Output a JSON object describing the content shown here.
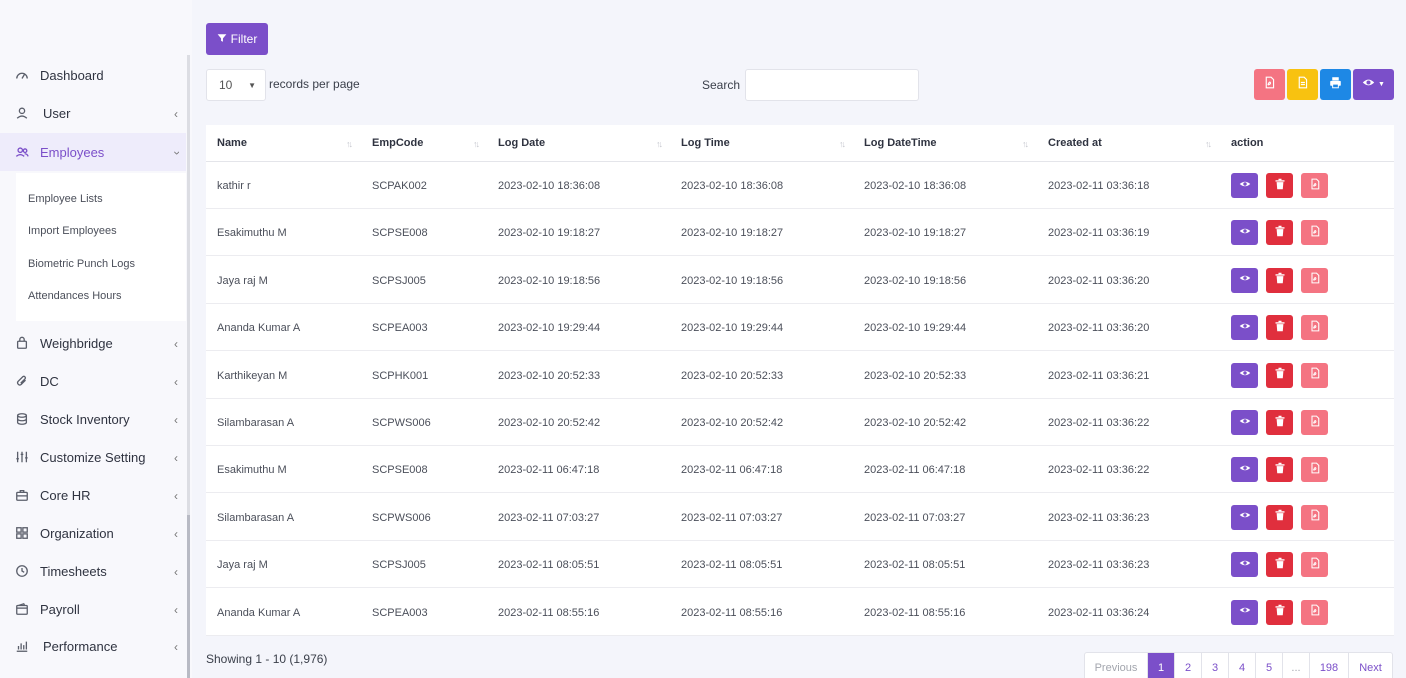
{
  "sidebar": {
    "items": [
      {
        "label": "Dashboard",
        "icon": "dashboard-icon"
      },
      {
        "label": "User",
        "icon": "user-icon"
      },
      {
        "label": "Employees",
        "icon": "users-icon"
      },
      {
        "label": "Weighbridge",
        "icon": "bag-icon"
      },
      {
        "label": "DC",
        "icon": "paperclip-icon"
      },
      {
        "label": "Stock Inventory",
        "icon": "database-icon"
      },
      {
        "label": "Customize Setting",
        "icon": "sliders-icon"
      },
      {
        "label": "Core HR",
        "icon": "briefcase-icon"
      },
      {
        "label": "Organization",
        "icon": "grid-icon"
      },
      {
        "label": "Timesheets",
        "icon": "clock-icon"
      },
      {
        "label": "Payroll",
        "icon": "wallet-icon"
      },
      {
        "label": "Performance",
        "icon": "bar-chart-icon"
      }
    ],
    "employees_submenu": [
      "Employee Lists",
      "Import Employees",
      "Biometric Punch Logs",
      "Attendances Hours"
    ]
  },
  "toolbar": {
    "filter_label": "Filter",
    "per_page_value": "10",
    "per_page_label": "records per page",
    "search_label": "Search",
    "search_value": "",
    "export_buttons": [
      {
        "name": "pdf-export",
        "color": "#f47482"
      },
      {
        "name": "csv-export",
        "color": "#f8c210"
      },
      {
        "name": "print",
        "color": "#1e88e5"
      },
      {
        "name": "column-visibility",
        "color": "#7b4fc9"
      }
    ]
  },
  "table": {
    "columns": [
      "Name",
      "EmpCode",
      "Log Date",
      "Log Time",
      "Log DateTime",
      "Created at",
      "action"
    ],
    "rows": [
      [
        "kathir r",
        "SCPAK002",
        "2023-02-10 18:36:08",
        "2023-02-10 18:36:08",
        "2023-02-10 18:36:08",
        "2023-02-11 03:36:18"
      ],
      [
        "Esakimuthu M",
        "SCPSE008",
        "2023-02-10 19:18:27",
        "2023-02-10 19:18:27",
        "2023-02-10 19:18:27",
        "2023-02-11 03:36:19"
      ],
      [
        "Jaya raj M",
        "SCPSJ005",
        "2023-02-10 19:18:56",
        "2023-02-10 19:18:56",
        "2023-02-10 19:18:56",
        "2023-02-11 03:36:20"
      ],
      [
        "Ananda Kumar A",
        "SCPEA003",
        "2023-02-10 19:29:44",
        "2023-02-10 19:29:44",
        "2023-02-10 19:29:44",
        "2023-02-11 03:36:20"
      ],
      [
        "Karthikeyan M",
        "SCPHK001",
        "2023-02-10 20:52:33",
        "2023-02-10 20:52:33",
        "2023-02-10 20:52:33",
        "2023-02-11 03:36:21"
      ],
      [
        "Silambarasan A",
        "SCPWS006",
        "2023-02-10 20:52:42",
        "2023-02-10 20:52:42",
        "2023-02-10 20:52:42",
        "2023-02-11 03:36:22"
      ],
      [
        "Esakimuthu M",
        "SCPSE008",
        "2023-02-11 06:47:18",
        "2023-02-11 06:47:18",
        "2023-02-11 06:47:18",
        "2023-02-11 03:36:22"
      ],
      [
        "Silambarasan A",
        "SCPWS006",
        "2023-02-11 07:03:27",
        "2023-02-11 07:03:27",
        "2023-02-11 07:03:27",
        "2023-02-11 03:36:23"
      ],
      [
        "Jaya raj M",
        "SCPSJ005",
        "2023-02-11 08:05:51",
        "2023-02-11 08:05:51",
        "2023-02-11 08:05:51",
        "2023-02-11 03:36:23"
      ],
      [
        "Ananda Kumar A",
        "SCPEA003",
        "2023-02-11 08:55:16",
        "2023-02-11 08:55:16",
        "2023-02-11 08:55:16",
        "2023-02-11 03:36:24"
      ]
    ]
  },
  "footer": {
    "showing": "Showing 1 - 10 (1,976)",
    "pagination": [
      "Previous",
      "1",
      "2",
      "3",
      "4",
      "5",
      "...",
      "198",
      "Next"
    ],
    "current_page": "1"
  },
  "colors": {
    "accent": "#7b4fc9",
    "danger": "#e02f3d",
    "pdf": "#f47482"
  }
}
